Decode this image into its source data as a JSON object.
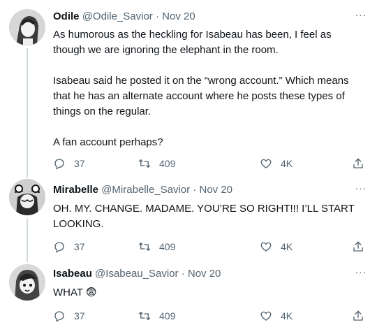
{
  "tweets": [
    {
      "name": "Odile",
      "handle": "@Odile_Savior",
      "sep": "·",
      "date": "Nov 20",
      "more": "···",
      "paragraphs": [
        "As humorous as the heckling for Isabeau has been, I feel as though we are ignoring the elephant in the room.",
        "Isabeau said he posted it on the “wrong account.” Which means that he has an alternate account where he posts these types of things on the regular.",
        "A fan account perhaps?"
      ],
      "replies": "37",
      "retweets": "409",
      "likes": "4K"
    },
    {
      "name": "Mirabelle",
      "handle": "@Mirabelle_Savior",
      "sep": "·",
      "date": "Nov 20",
      "more": "···",
      "paragraphs": [
        "OH. MY. CHANGE. MADAME. YOU’RE SO RIGHT!!! I’LL START LOOKING."
      ],
      "replies": "37",
      "retweets": "409",
      "likes": "4K"
    },
    {
      "name": "Isabeau",
      "handle": "@Isabeau_Savior",
      "sep": "·",
      "date": "Nov 20",
      "more": "···",
      "paragraphs": [
        "WHAT 😨"
      ],
      "replies": "37",
      "retweets": "409",
      "likes": "4K"
    }
  ],
  "colors": {
    "text": "#0f1419",
    "secondary": "#536471",
    "thread_line": "#cfd9de"
  },
  "icons": [
    "reply-icon",
    "retweet-icon",
    "like-icon",
    "share-icon",
    "more-icon"
  ]
}
